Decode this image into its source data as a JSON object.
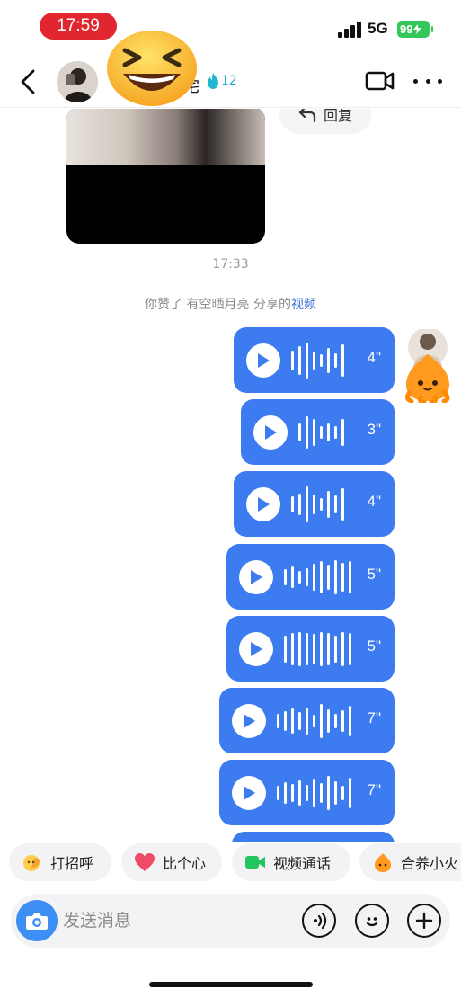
{
  "status_bar": {
    "time": "17:59",
    "network": "5G",
    "battery": "99"
  },
  "header": {
    "title_visible": "宅",
    "fire_count": "12"
  },
  "chat": {
    "reply_label": "回复",
    "timestamp": "17:33",
    "notice_prefix": "你赞了 有空晒月亮 分享的",
    "notice_link": "视频",
    "voice_messages": [
      {
        "duration": "4\""
      },
      {
        "duration": "3\""
      },
      {
        "duration": "4\""
      },
      {
        "duration": "5\""
      },
      {
        "duration": "5\""
      },
      {
        "duration": "7\""
      },
      {
        "duration": "7\""
      }
    ]
  },
  "quick_replies": [
    {
      "label": "打招呼",
      "icon": "wave-hand-icon"
    },
    {
      "label": "比个心",
      "icon": "heart-icon"
    },
    {
      "label": "视频通话",
      "icon": "video-call-icon"
    },
    {
      "label": "合养小火",
      "icon": "fire-pet-icon"
    }
  ],
  "input": {
    "placeholder": "发送消息"
  },
  "colors": {
    "bubble": "#3d7bf0",
    "accent_blue": "#3d8ef5",
    "time_pill": "#e1262f",
    "battery": "#34c759"
  }
}
